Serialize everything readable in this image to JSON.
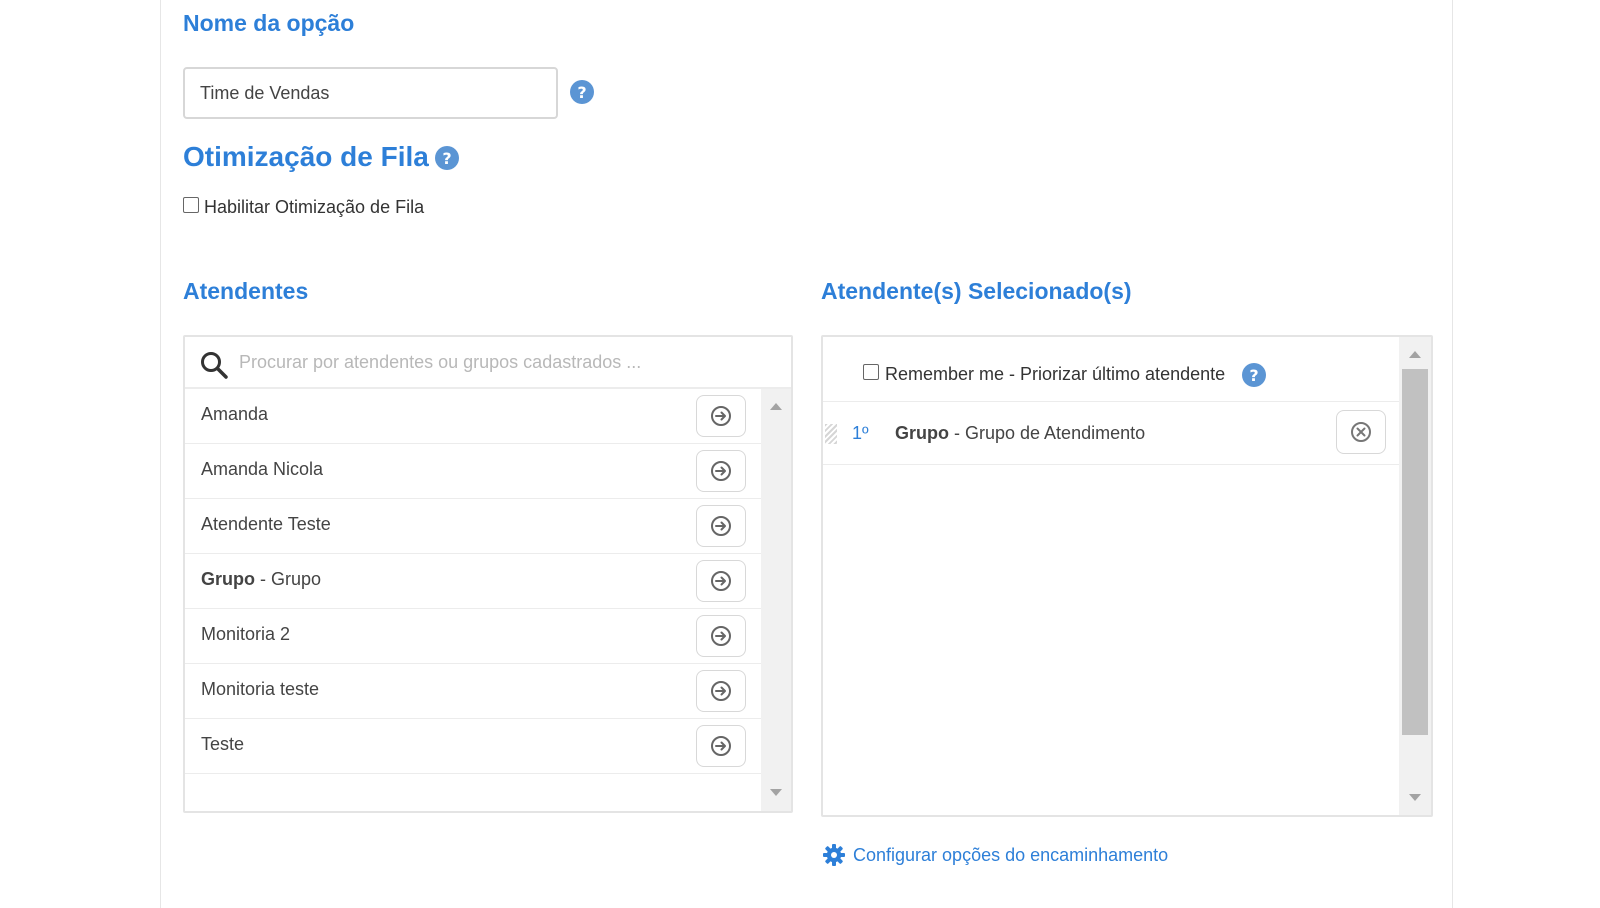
{
  "option_name": {
    "title": "Nome da opção",
    "value": "Time de Vendas",
    "help_icon": "question-circle-icon"
  },
  "queue_optimization": {
    "title": "Otimização de Fila",
    "help_icon": "question-circle-icon",
    "checkbox_label": "Habilitar Otimização de Fila",
    "checked": false
  },
  "attendants": {
    "title": "Atendentes",
    "search_placeholder": "Procurar por atendentes ou grupos cadastrados ...",
    "items": [
      {
        "prefix": "",
        "label": "Amanda"
      },
      {
        "prefix": "",
        "label": "Amanda Nicola"
      },
      {
        "prefix": "",
        "label": "Atendente Teste"
      },
      {
        "prefix": "Grupo",
        "label": " - Grupo"
      },
      {
        "prefix": "",
        "label": "Monitoria 2"
      },
      {
        "prefix": "",
        "label": "Monitoria teste"
      },
      {
        "prefix": "",
        "label": "Teste"
      }
    ],
    "add_icon": "arrow-right-circle-icon"
  },
  "selected": {
    "title": "Atendente(s) Selecionado(s)",
    "remember_label": "Remember me - Priorizar último atendente",
    "remember_checked": false,
    "items": [
      {
        "order": "1º",
        "prefix": "Grupo",
        "label": " - Grupo de Atendimento"
      }
    ],
    "remove_icon": "x-circle-icon"
  },
  "configure_link": {
    "label": "Configurar opções do encaminhamento",
    "icon": "gear-icon"
  },
  "colors": {
    "accent": "#2d7fd8",
    "help": "#5b95d4"
  }
}
